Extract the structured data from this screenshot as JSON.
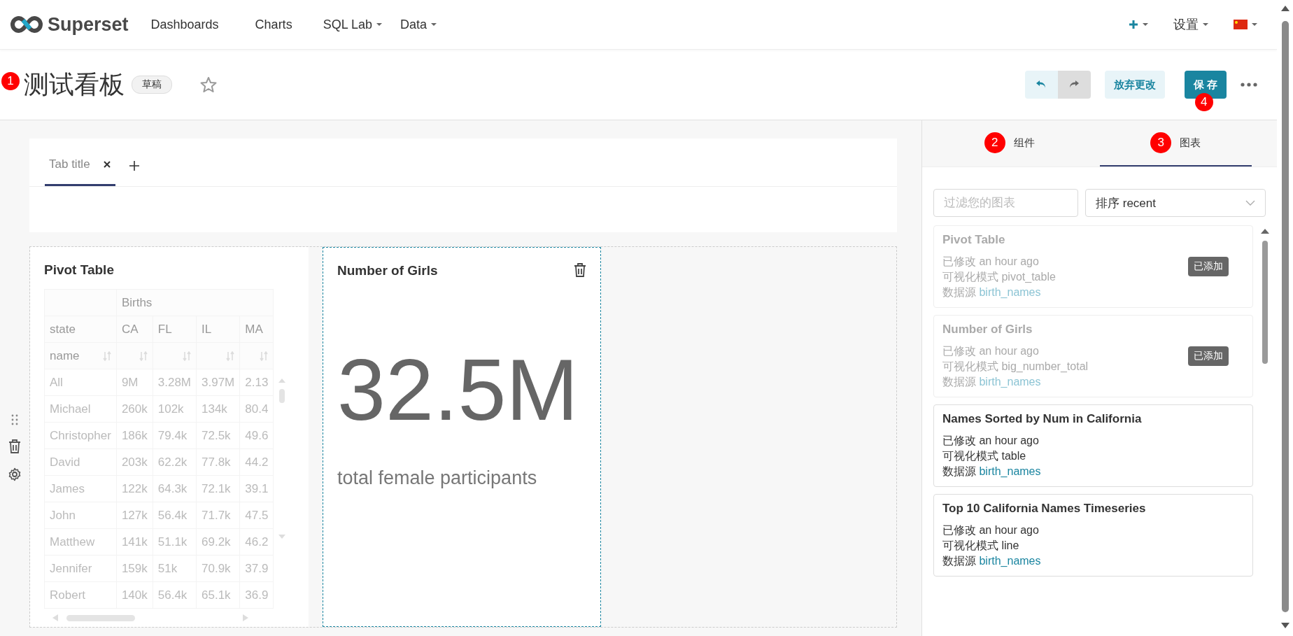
{
  "nav": {
    "brand": "Superset",
    "items": [
      {
        "label": "Dashboards",
        "dropdown": false
      },
      {
        "label": "Charts",
        "dropdown": false
      },
      {
        "label": "SQL Lab",
        "dropdown": true
      },
      {
        "label": "Data",
        "dropdown": true
      }
    ],
    "settings": "设置"
  },
  "header": {
    "title": "测试看板",
    "title_marker": "1",
    "status": "草稿",
    "starred": false,
    "discard": "放弃更改",
    "save": "保 存",
    "save_marker": "4"
  },
  "tabs": [
    {
      "label": "Tab title",
      "selected": true
    }
  ],
  "pivot": {
    "title": "Pivot Table",
    "group": "Births",
    "name_label": "name",
    "columns": [
      "state",
      "CA",
      "FL",
      "IL",
      "MA"
    ],
    "rows": [
      [
        "All",
        "9M",
        "3.28M",
        "3.97M",
        "2.13"
      ],
      [
        "Michael",
        "260k",
        "102k",
        "134k",
        "80.4"
      ],
      [
        "Christopher",
        "186k",
        "79.4k",
        "72.5k",
        "49.6"
      ],
      [
        "David",
        "203k",
        "62.2k",
        "77.8k",
        "44.2"
      ],
      [
        "James",
        "122k",
        "64.3k",
        "72.1k",
        "39.1"
      ],
      [
        "John",
        "127k",
        "56.4k",
        "71.7k",
        "47.5"
      ],
      [
        "Matthew",
        "141k",
        "51.1k",
        "69.2k",
        "46.2"
      ],
      [
        "Jennifer",
        "159k",
        "51k",
        "70.9k",
        "37.9"
      ],
      [
        "Robert",
        "140k",
        "56.4k",
        "65.1k",
        "36.9"
      ]
    ]
  },
  "big_number": {
    "title": "Number of Girls",
    "value": "32.5M",
    "subtitle": "total female participants",
    "selected": true
  },
  "panel": {
    "tabs": [
      {
        "label": "组件",
        "marker": "2",
        "selected": false
      },
      {
        "label": "图表",
        "marker": "3",
        "selected": true
      }
    ],
    "filter_placeholder": "过滤您的图表",
    "sort": "排序 recent",
    "charts": [
      {
        "title": "Pivot Table",
        "modified": "已修改 an hour ago",
        "viz": "可视化模式 pivot_table",
        "source_label": "数据源",
        "source": "birth_names",
        "added": true,
        "badge": "已添加"
      },
      {
        "title": "Number of Girls",
        "modified": "已修改 an hour ago",
        "viz": "可视化模式 big_number_total",
        "source_label": "数据源",
        "source": "birth_names",
        "added": true,
        "badge": "已添加"
      },
      {
        "title": "Names Sorted by Num in California",
        "modified": "已修改 an hour ago",
        "viz": "可视化模式 table",
        "source_label": "数据源",
        "source": "birth_names",
        "added": false
      },
      {
        "title": "Top 10 California Names Timeseries",
        "modified": "已修改 an hour ago",
        "viz": "可视化模式 line",
        "source_label": "数据源",
        "source": "birth_names",
        "added": false
      }
    ]
  }
}
